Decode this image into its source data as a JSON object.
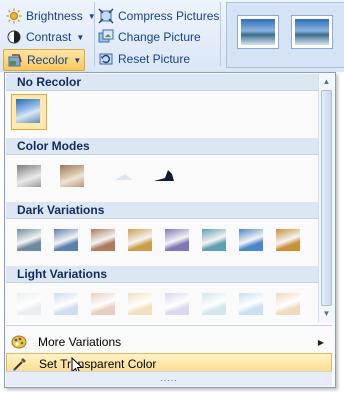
{
  "ribbon": {
    "brightness": "Brightness",
    "contrast": "Contrast",
    "recolor": "Recolor",
    "compress": "Compress Pictures",
    "change": "Change Picture",
    "reset": "Reset Picture"
  },
  "menu": {
    "sections": {
      "no_recolor": "No Recolor",
      "color_modes": "Color Modes",
      "dark_variations": "Dark Variations",
      "light_variations": "Light Variations"
    },
    "items": {
      "more_variations": "More Variations",
      "set_transparent": "Set Transparent Color"
    },
    "grip": "....."
  },
  "colors": {
    "dark": [
      "#6e8a9e",
      "#5b7fb0",
      "#b07a5e",
      "#c9a048",
      "#7f78b8",
      "#5f9fb0",
      "#4a86c8",
      "#c99038"
    ],
    "light": [
      "#e9ecef",
      "#c9daee",
      "#e8c9b8",
      "#f0dfb8",
      "#d9d4ec",
      "#cfe4ea",
      "#c6dcf2",
      "#efd6b8"
    ]
  }
}
